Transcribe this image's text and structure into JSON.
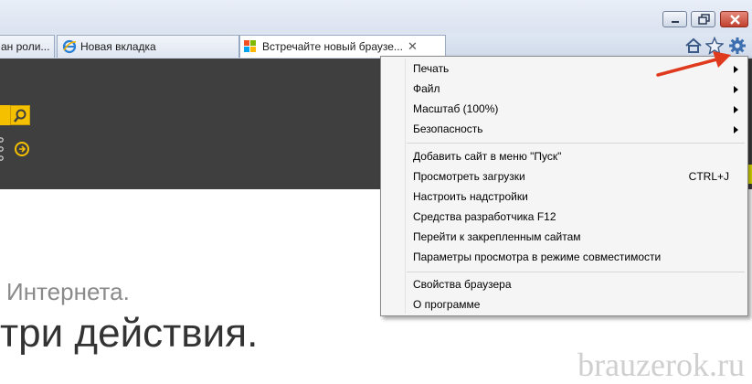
{
  "tabs": [
    {
      "label": "ан роли...",
      "has_close": false
    },
    {
      "label": "Новая вкладка",
      "icon": "ie-icon",
      "has_close": false
    },
    {
      "label": "Встречайте новый браузе...",
      "icon": "windows-logo-icon",
      "has_close": true,
      "active": true
    }
  ],
  "toolbar_icons": [
    "home-icon",
    "star-icon",
    "gear-icon"
  ],
  "window_buttons": [
    "minimize",
    "restore",
    "close"
  ],
  "menu": {
    "items_group1": [
      {
        "label": "Печать",
        "submenu": true
      },
      {
        "label": "Файл",
        "submenu": true
      },
      {
        "label": "Масштаб (100%)",
        "submenu": true
      },
      {
        "label": "Безопасность",
        "submenu": true
      }
    ],
    "items_group2": [
      {
        "label": "Добавить сайт в меню \"Пуск\""
      },
      {
        "label": "Просмотреть загрузки",
        "shortcut": "CTRL+J",
        "highlighted": true
      },
      {
        "label": "Настроить надстройки"
      },
      {
        "label": "Средства разработчика F12"
      },
      {
        "label": "Перейти к закрепленным сайтам"
      },
      {
        "label": "Параметры просмотра в режиме совместимости"
      }
    ],
    "items_group3": [
      {
        "label": "Свойства браузера"
      },
      {
        "label": "О программе"
      }
    ]
  },
  "page": {
    "text1": "Интернета.",
    "text2": "три действия."
  },
  "watermark": "brauzerok.ru",
  "colors": {
    "highlight": "#f0f000",
    "accent_yellow": "#f4c000",
    "arrow_red": "#e03a1e",
    "dark_band": "#3f3f3f"
  }
}
